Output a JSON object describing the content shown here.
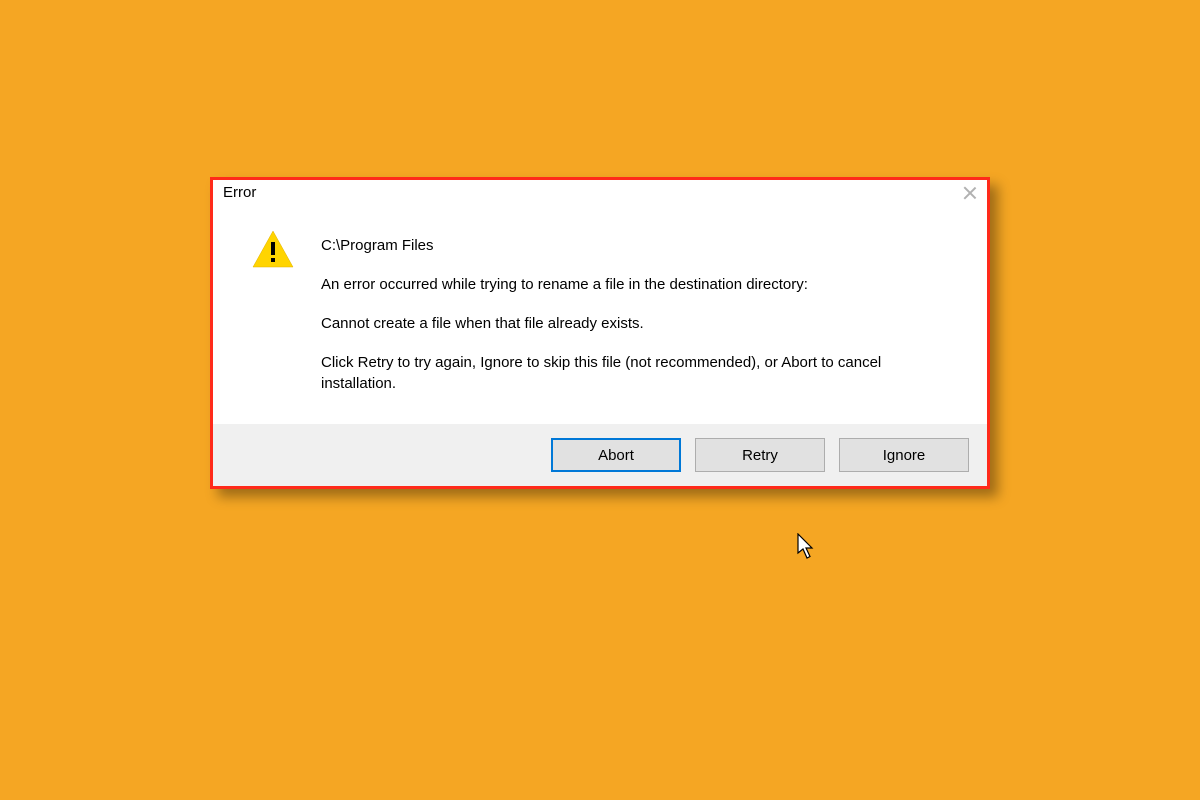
{
  "dialog": {
    "title": "Error",
    "path": "C:\\Program Files",
    "line1": "An error occurred while trying to rename a file in the destination directory:",
    "line2": "Cannot create a file when that file already exists.",
    "line3": "Click Retry to try again, Ignore to skip this file (not recommended), or Abort to cancel installation.",
    "buttons": {
      "abort": "Abort",
      "retry": "Retry",
      "ignore": "Ignore"
    }
  }
}
